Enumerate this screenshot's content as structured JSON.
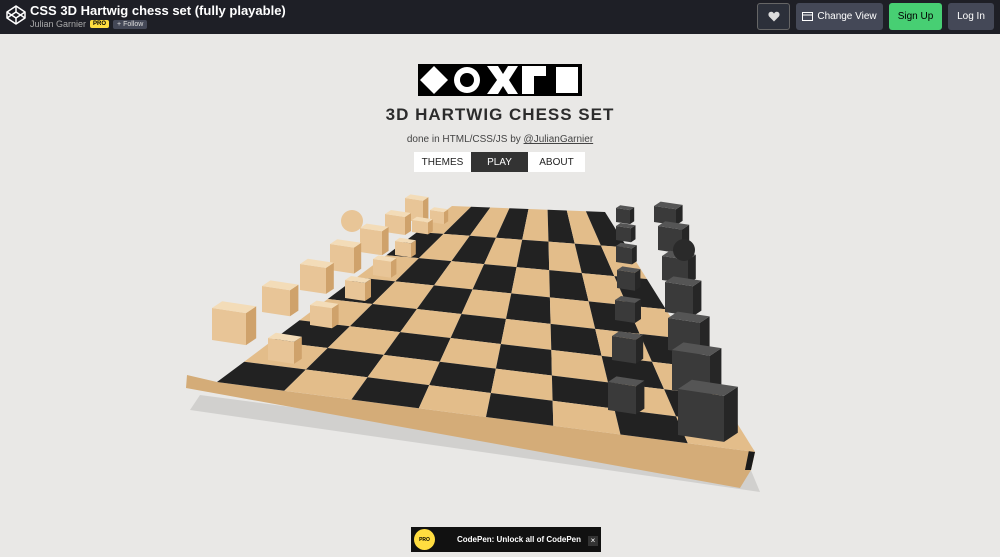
{
  "topbar": {
    "title": "CSS 3D Hartwig chess set (fully playable)",
    "author": "Julian Garnier",
    "pro_badge": "PRO",
    "follow_label": "+ Follow",
    "change_view_label": "Change View",
    "signup_label": "Sign Up",
    "login_label": "Log In"
  },
  "header": {
    "title": "3D HARTWIG CHESS SET",
    "subtitle_prefix": "done in HTML/CSS/JS by ",
    "subtitle_link": "@JulianGarnier",
    "tabs": [
      {
        "label": "THEMES",
        "active": false
      },
      {
        "label": "PLAY",
        "active": true
      },
      {
        "label": "ABOUT",
        "active": false
      }
    ]
  },
  "colors": {
    "light_square": "#e3bd8a",
    "dark_square": "#222222",
    "accent_green": "#47cf73",
    "pro_yellow": "#ffdd40"
  },
  "icons": [
    "codepen-logo-icon",
    "heart-icon",
    "change-view-icon",
    "close-icon"
  ],
  "promo": {
    "badge": "PRO",
    "text": "CodePen: Unlock all of CodePen",
    "close": "×"
  }
}
